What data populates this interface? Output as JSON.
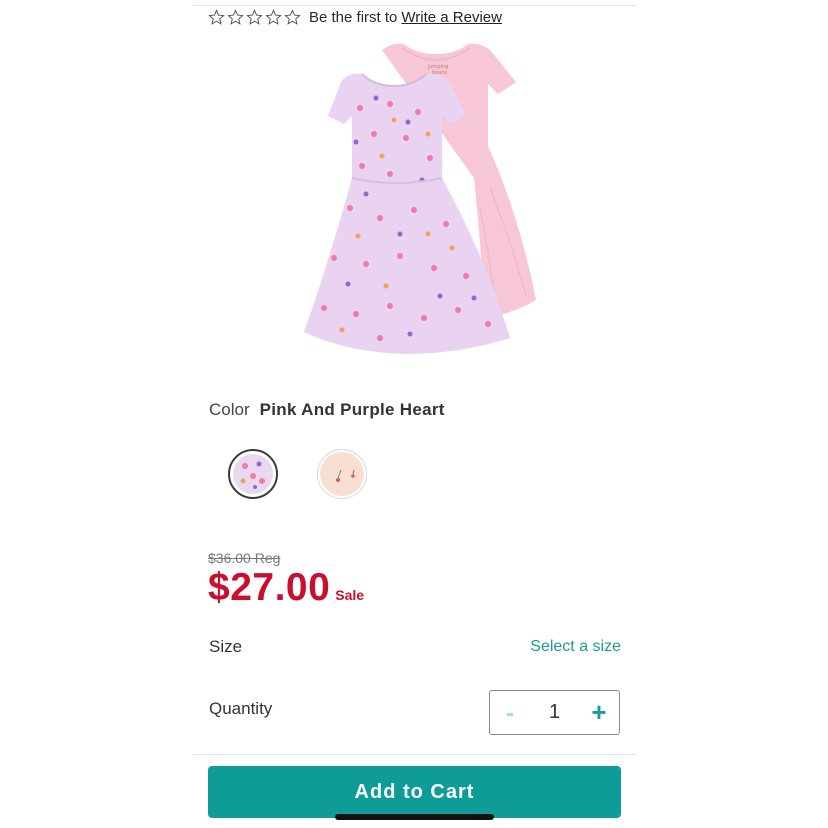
{
  "rating": {
    "stars_filled": 0,
    "stars_total": 5,
    "prompt_text": "Be the first to",
    "review_link": "Write a Review"
  },
  "product": {
    "image_icon": "dress-image",
    "color_label": "Color",
    "color_value": "Pink And Purple Heart",
    "swatches": [
      {
        "name": "Pink And Purple Heart",
        "selected": true,
        "color": "#ead8f1"
      },
      {
        "name": "Peach Cherry",
        "selected": false,
        "color": "#f8dfd2"
      }
    ]
  },
  "pricing": {
    "regular": "$36.00 Reg",
    "sale": "$27.00",
    "sale_label": "Sale",
    "sale_color": "#c8102e"
  },
  "size": {
    "label": "Size",
    "action": "Select a size"
  },
  "quantity": {
    "label": "Quantity",
    "minus": "-",
    "value": "1",
    "plus": "+"
  },
  "cart": {
    "button_label": "Add to Cart",
    "button_color": "#0f9c98"
  }
}
